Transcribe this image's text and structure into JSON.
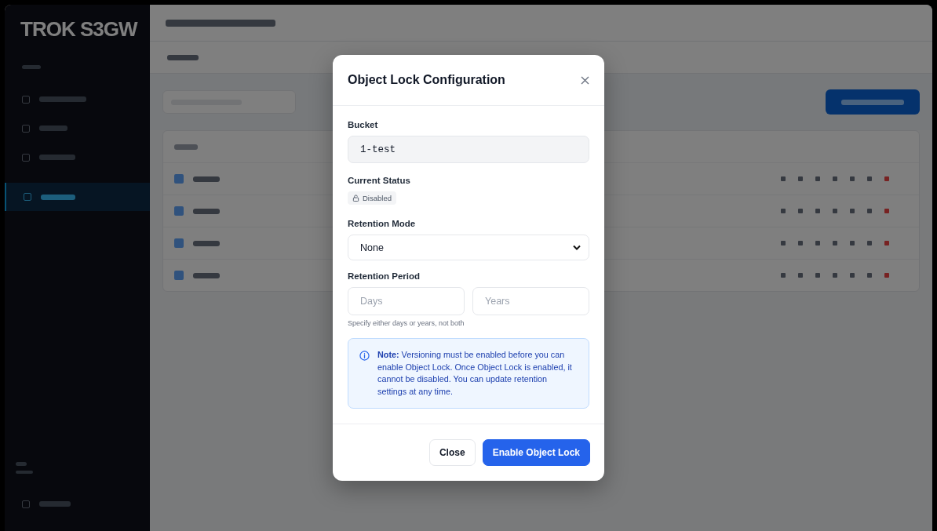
{
  "sidebar": {
    "logo": "TROK S3GW",
    "items": [
      {
        "selected": false
      },
      {
        "selected": false
      },
      {
        "selected": false
      },
      {
        "selected": true
      }
    ]
  },
  "dialog": {
    "title": "Object Lock Configuration",
    "bucket": {
      "label": "Bucket",
      "value": "1-test"
    },
    "status": {
      "label": "Current Status",
      "badge": "Disabled",
      "enabled": false
    },
    "retention_mode": {
      "label": "Retention Mode",
      "value": "None"
    },
    "retention_period": {
      "label": "Retention Period",
      "days_placeholder": "Days",
      "years_placeholder": "Years",
      "hint": "Specify either days or years, not both"
    },
    "note": "**Note:** Versioning must be enabled before you can enable Object Lock. Once Object Lock is enabled, it cannot be disabled. You can update retention settings at any time.",
    "buttons": [
      {
        "label": "Close",
        "kind": "secondary"
      },
      {
        "label": "Enable Object Lock",
        "kind": "primary"
      }
    ]
  }
}
